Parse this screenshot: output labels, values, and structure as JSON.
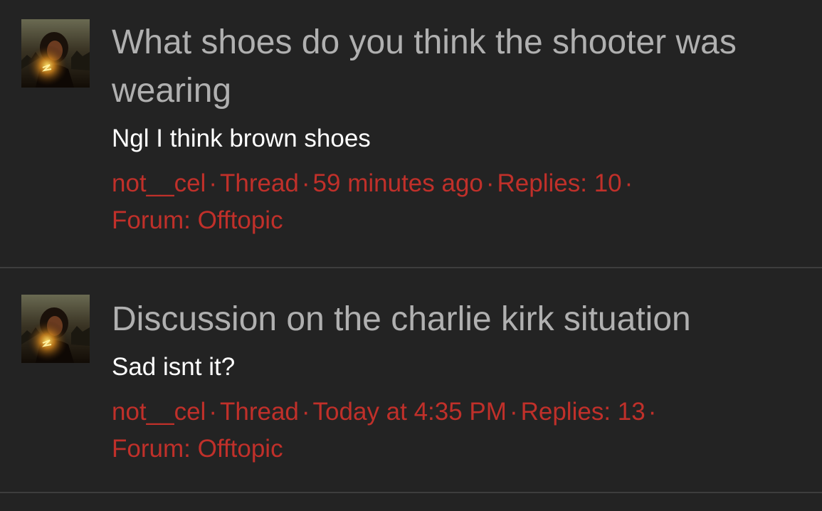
{
  "results": [
    {
      "title": "What shoes do you think the shooter was wearing",
      "snippet": "Ngl I think brown shoes",
      "author": "not__cel",
      "type": "Thread",
      "time": "59 minutes ago",
      "replies": "Replies: 10",
      "forum_label": "Forum:",
      "forum": "Offtopic"
    },
    {
      "title": "Discussion on the charlie kirk situation",
      "snippet": "Sad isnt it?",
      "author": "not__cel",
      "type": "Thread",
      "time": "Today at 4:35 PM",
      "replies": "Replies: 13",
      "forum_label": "Forum:",
      "forum": "Offtopic"
    }
  ],
  "colors": {
    "background": "#232323",
    "title": "#b0b0b0",
    "snippet": "#ffffff",
    "meta": "#c0302a",
    "divider": "#3d3d3d"
  },
  "separator": "·"
}
